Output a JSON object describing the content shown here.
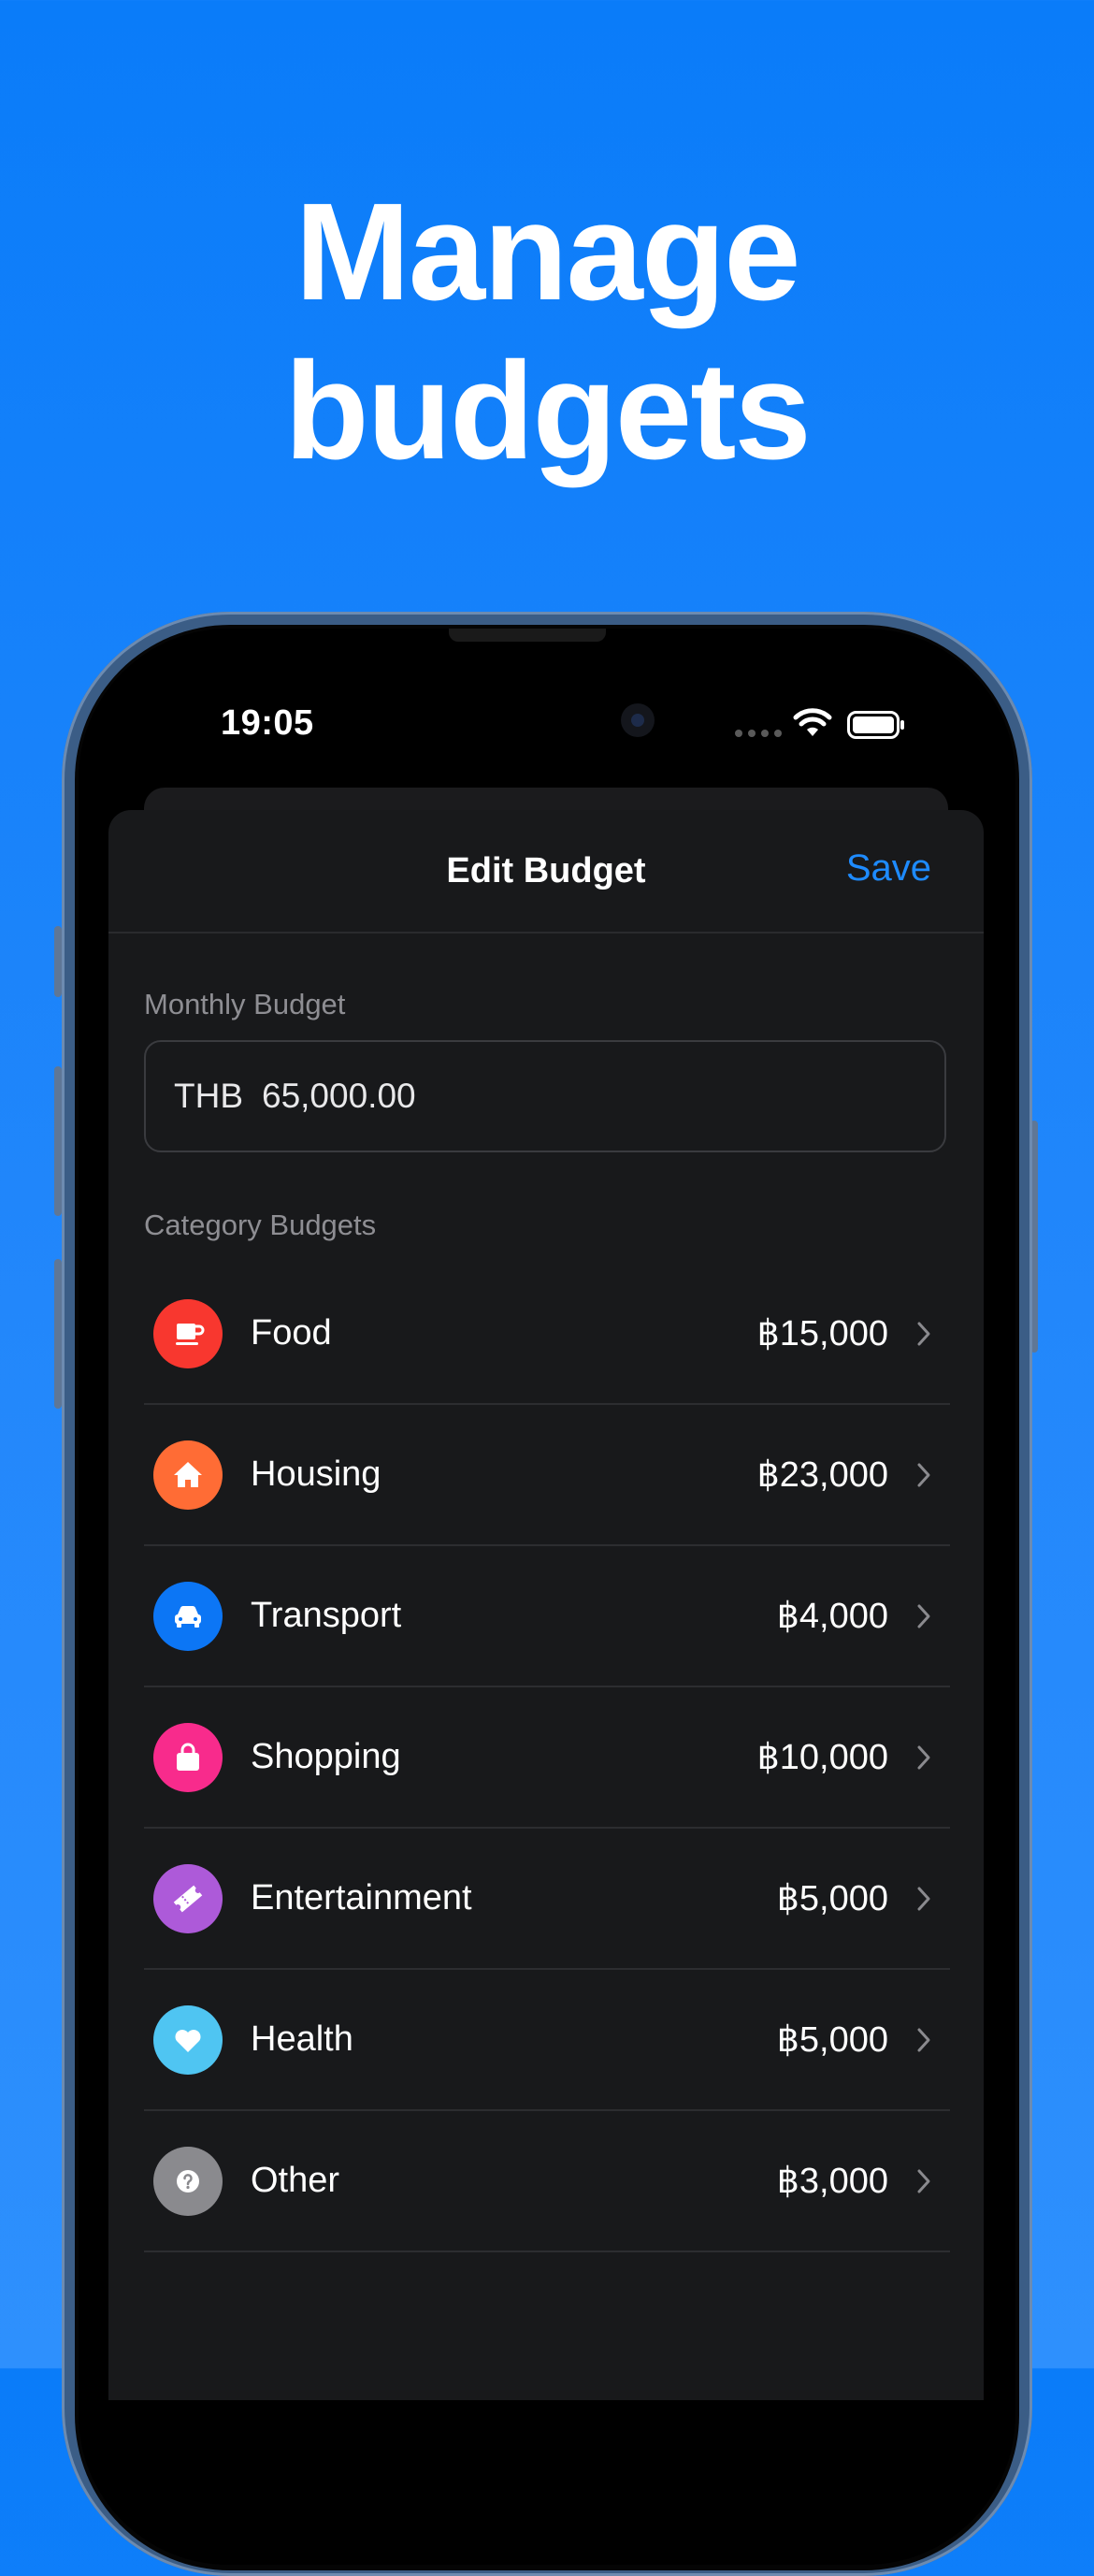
{
  "headline": {
    "line1": "Manage",
    "line2": "budgets"
  },
  "status_bar": {
    "time": "19:05"
  },
  "sheet": {
    "title": "Edit Budget",
    "save_label": "Save"
  },
  "monthly": {
    "label": "Monthly Budget",
    "currency": "THB",
    "value": "65,000.00"
  },
  "categories_label": "Category Budgets",
  "categories": [
    {
      "name": "Food",
      "amount": "฿15,000",
      "icon": "cup-icon",
      "color": "#f8372f"
    },
    {
      "name": "Housing",
      "amount": "฿23,000",
      "icon": "house-icon",
      "color": "#ff6c35"
    },
    {
      "name": "Transport",
      "amount": "฿4,000",
      "icon": "car-icon",
      "color": "#0c76f5"
    },
    {
      "name": "Shopping",
      "amount": "฿10,000",
      "icon": "bag-icon",
      "color": "#f82b8c"
    },
    {
      "name": "Entertainment",
      "amount": "฿5,000",
      "icon": "ticket-icon",
      "color": "#ad5ad9"
    },
    {
      "name": "Health",
      "amount": "฿5,000",
      "icon": "heart-icon",
      "color": "#4fc5f2"
    },
    {
      "name": "Other",
      "amount": "฿3,000",
      "icon": "question-icon",
      "color": "#8a8a8e"
    }
  ],
  "colors": {
    "background": "#0a7cf9",
    "accent": "#1e8bff",
    "sheet": "#18191b"
  }
}
